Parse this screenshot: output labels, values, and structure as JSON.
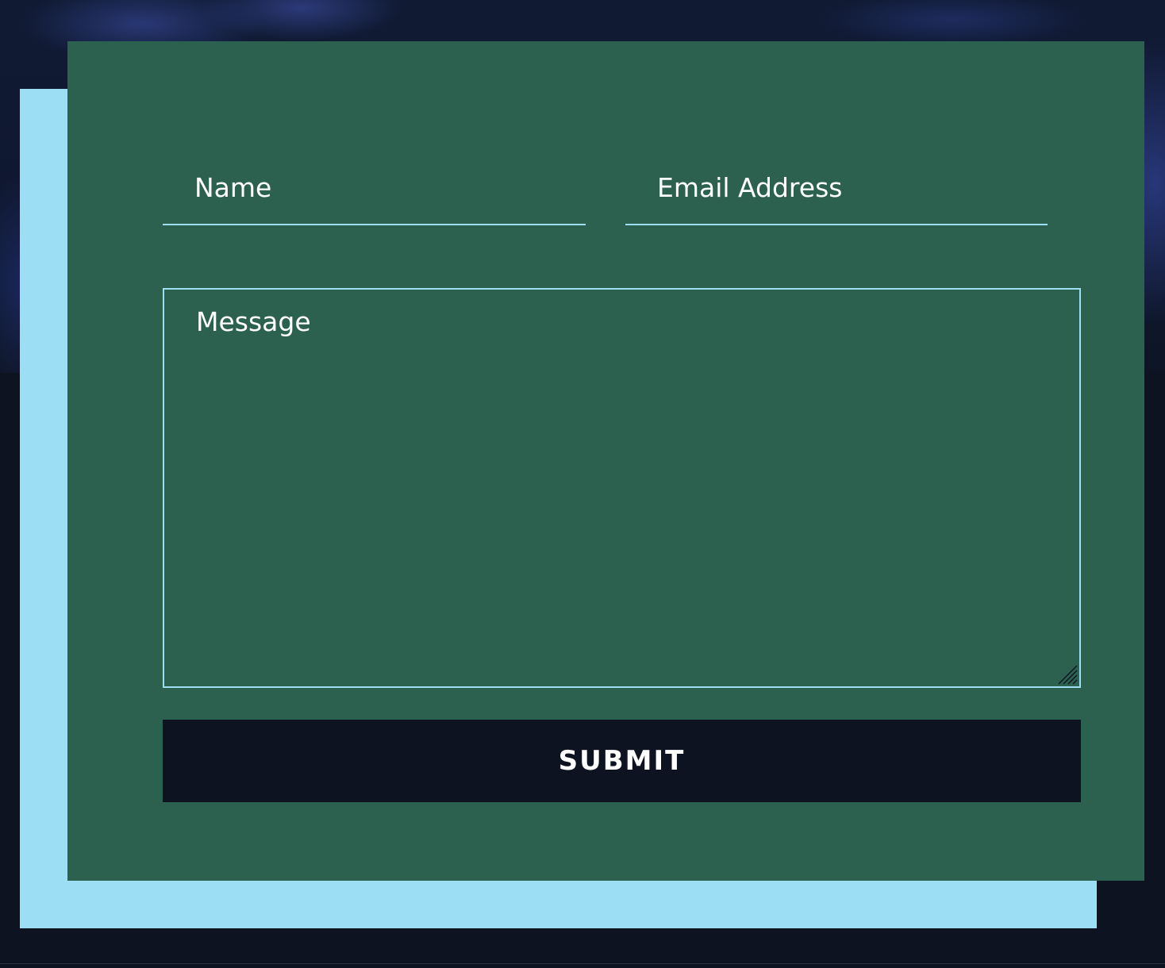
{
  "form": {
    "name_placeholder": "Name",
    "email_placeholder": "Email Address",
    "message_placeholder": "Message",
    "submit_label": "SUBMIT"
  },
  "colors": {
    "card_background": "#2c6150",
    "accent": "#9cdef4",
    "page_background": "#0d1321",
    "button_background": "#0e1321",
    "text": "#ffffff"
  }
}
